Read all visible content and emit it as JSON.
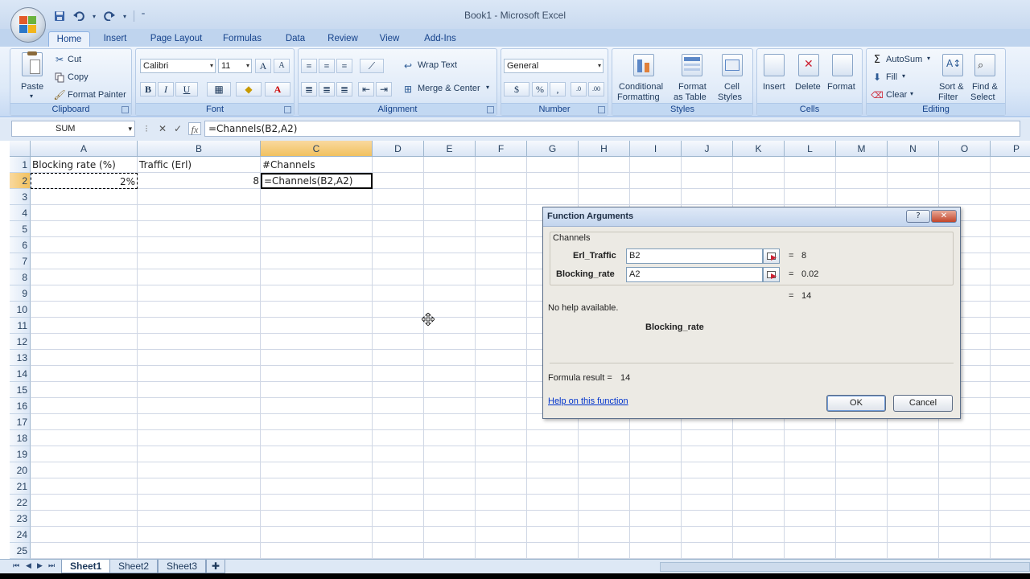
{
  "window": {
    "title": "Book1 - Microsoft Excel"
  },
  "qat": {
    "icons": [
      "save-icon",
      "undo-icon",
      "redo-icon",
      "customize-icon"
    ]
  },
  "tabs": [
    "Home",
    "Insert",
    "Page Layout",
    "Formulas",
    "Data",
    "Review",
    "View",
    "Add-Ins"
  ],
  "ribbon": {
    "clipboard": {
      "label": "Clipboard",
      "paste": "Paste",
      "cut": "Cut",
      "copy": "Copy",
      "format_painter": "Format Painter"
    },
    "font": {
      "label": "Font",
      "font_name": "Calibri",
      "font_size": "11"
    },
    "alignment": {
      "label": "Alignment",
      "wrap_text": "Wrap Text",
      "merge_center": "Merge & Center"
    },
    "number": {
      "label": "Number",
      "format": "General"
    },
    "styles": {
      "label": "Styles",
      "conditional_1": "Conditional",
      "conditional_2": "Formatting",
      "format_table_1": "Format",
      "format_table_2": "as Table",
      "cell_styles_1": "Cell",
      "cell_styles_2": "Styles"
    },
    "cells": {
      "label": "Cells",
      "insert": "Insert",
      "delete": "Delete",
      "format": "Format"
    },
    "editing": {
      "label": "Editing",
      "autosum": "AutoSum",
      "fill": "Fill",
      "clear": "Clear",
      "sort_1": "Sort &",
      "sort_2": "Filter",
      "find_1": "Find &",
      "find_2": "Select"
    }
  },
  "formula_bar": {
    "name_box": "SUM",
    "formula": "=Channels(B2,A2)"
  },
  "grid": {
    "columns": [
      "A",
      "B",
      "C",
      "D",
      "E",
      "F",
      "G",
      "H",
      "I",
      "J",
      "K",
      "L",
      "M",
      "N",
      "O",
      "P"
    ],
    "rows": [
      "1",
      "2",
      "3",
      "4",
      "5",
      "6",
      "7",
      "8",
      "9",
      "10",
      "11",
      "12",
      "13",
      "14",
      "15",
      "16",
      "17",
      "18",
      "19",
      "20",
      "21",
      "22",
      "23",
      "24",
      "25"
    ],
    "cells": {
      "A1": "Blocking rate (%)",
      "B1": "Traffic (Erl)",
      "C1": "#Channels",
      "A2": "2%",
      "B2": "8",
      "C2": "=Channels(B2,A2)"
    }
  },
  "sheets": [
    "Sheet1",
    "Sheet2",
    "Sheet3"
  ],
  "dialog": {
    "title": "Function Arguments",
    "function_name": "Channels",
    "args": [
      {
        "label": "Erl_Traffic",
        "value": "B2",
        "result": "8"
      },
      {
        "label": "Blocking_rate",
        "value": "A2",
        "result": "0.02"
      }
    ],
    "eq": "=",
    "overall_result": "14",
    "help_text": "No help available.",
    "arg_desc": "Blocking_rate",
    "formula_result_label": "Formula result =",
    "formula_result_value": "14",
    "help_link": "Help on this function",
    "ok": "OK",
    "cancel": "Cancel",
    "help_btn": "?"
  }
}
